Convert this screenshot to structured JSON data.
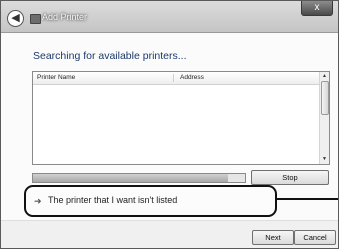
{
  "window": {
    "title": "Add Printer",
    "back_glyph": "◀",
    "close_glyph": "x"
  },
  "page": {
    "heading": "Searching for available printers...",
    "columns": [
      "Printer Name",
      "Address"
    ],
    "rows": [],
    "search_progress_fraction": 0.92,
    "stop_label": "Stop",
    "not_listed_link": "The printer that I want isn't listed",
    "link_icon": "arrow-link-icon"
  },
  "footer": {
    "next_label": "Next",
    "cancel_label": "Cancel"
  }
}
